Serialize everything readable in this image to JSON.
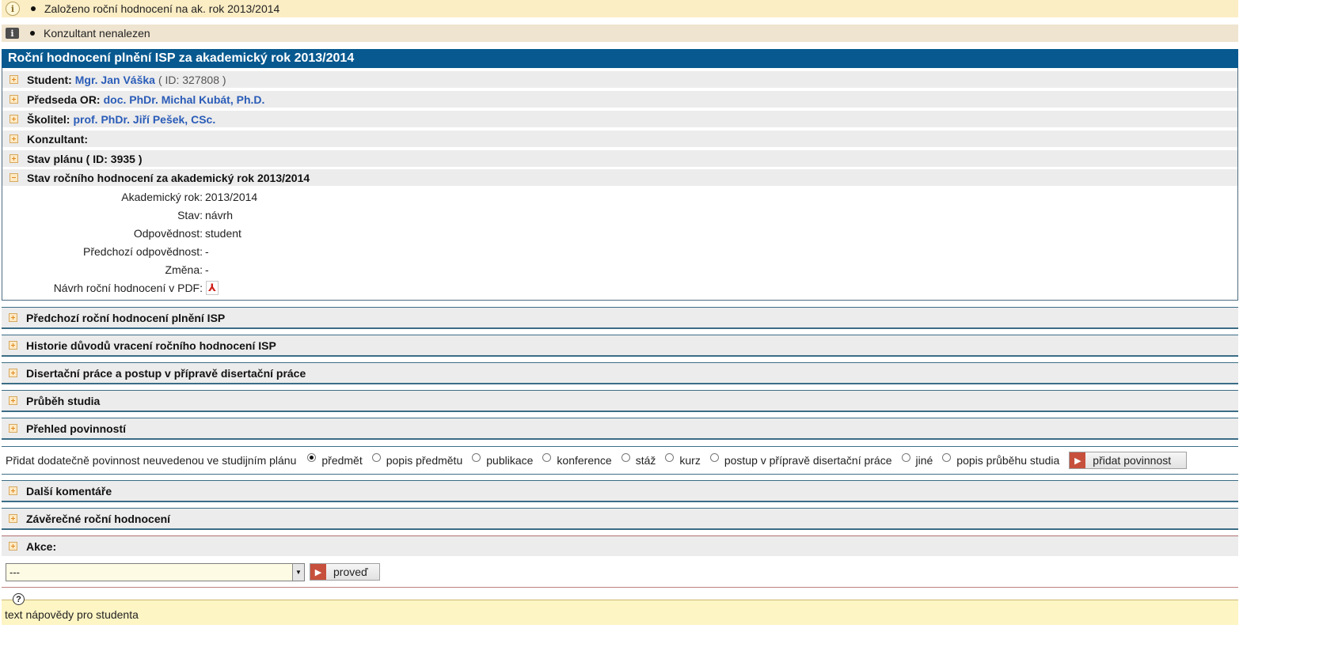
{
  "messages": {
    "info": "Založeno roční hodnocení na ak. rok 2013/2014",
    "warning": "Konzultant nenalezen"
  },
  "panel": {
    "title": "Roční hodnocení plnění ISP za akademický rok 2013/2014",
    "student": {
      "label": "Student:",
      "name": "Mgr. Jan Váška",
      "id_text": "( ID: 327808 )"
    },
    "chair": {
      "label": "Předseda OR:",
      "name": "doc. PhDr. Michal Kubát, Ph.D."
    },
    "supervisor": {
      "label": "Školitel:",
      "name": "prof. PhDr. Jiří Pešek, CSc."
    },
    "consultant": {
      "label": "Konzultant:"
    },
    "plan_state": {
      "label": "Stav plánu ( ID: 3935 )"
    },
    "eval_state": {
      "label": "Stav ročního hodnocení za akademický rok 2013/2014"
    },
    "details": [
      {
        "label": "Akademický rok:",
        "value": "2013/2014"
      },
      {
        "label": "Stav:",
        "value": "návrh"
      },
      {
        "label": "Odpovědnost:",
        "value": "student"
      },
      {
        "label": "Předchozí odpovědnost:",
        "value": "-"
      },
      {
        "label": "Změna:",
        "value": "-"
      },
      {
        "label": "Návrh roční hodnocení v PDF:",
        "value": ""
      }
    ]
  },
  "sections": {
    "previous": "Předchozí roční hodnocení plnění ISP",
    "history": "Historie důvodů vracení ročního hodnocení ISP",
    "dissertation": "Disertační práce a postup v přípravě disertační práce",
    "course": "Průběh studia",
    "obligations": "Přehled povinností",
    "comments": "Další komentáře",
    "final": "Závěrečné roční hodnocení",
    "action": "Akce:"
  },
  "add_obligation": {
    "label": "Přidat dodatečně povinnost neuvedenou ve studijním plánu",
    "options": [
      "předmět",
      "popis předmětu",
      "publikace",
      "konference",
      "stáž",
      "kurz",
      "postup v přípravě disertační práce",
      "jiné",
      "popis průběhu studia"
    ],
    "selected": "předmět",
    "button": "přidat povinnost"
  },
  "action": {
    "select_value": "---",
    "button": "proveď"
  },
  "help": {
    "text": "text nápovědy pro studenta"
  },
  "icons": {
    "info": "info-icon",
    "warning": "warning-icon",
    "expand": "plus-icon",
    "collapse": "minus-icon",
    "pdf": "pdf-icon",
    "help": "help-icon"
  }
}
